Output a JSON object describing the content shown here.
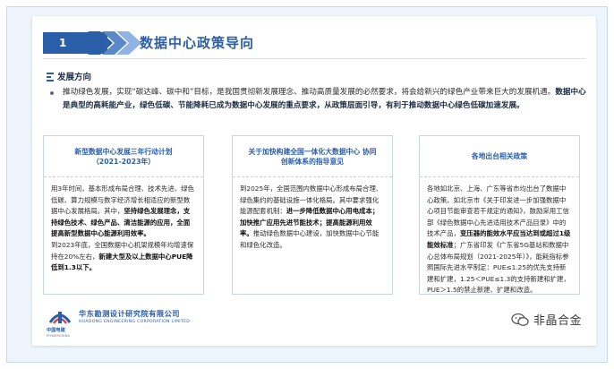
{
  "header": {
    "number": "1",
    "title": "数据中心政策导向"
  },
  "section": {
    "title": "发展方向"
  },
  "intro": {
    "normal": "推动绿色发展，实现“碳达峰、碳中和”目标，是我国贯彻新发展理念、推动高质量发展的必然要求，将会给新兴的绿色产业带来巨大的发展机遇。",
    "bold": "数据中心是典型的高耗能产业，绿色低碳、节能降耗已成为数据中心发展的重点要求，从政策层面引导，有利于推动数据中心绿色低碳加速发展。"
  },
  "cards": [
    {
      "title_line1": "新型数据中心发展三年行动计划",
      "title_line2": "（2021-2023年）",
      "p1_normal": "用3年时间，基本形成布局合理、技术先进、绿色低碳、算力规模与数字经济增长相适应的新型数据中心发展格局。其中，",
      "p1_bold": "坚持绿色发展理念，支持绿色技术、绿色产品、清洁能源的应用，全面提高新型数据中心能源利用效率。",
      "p2_normal": "到2023年底，全国数据中心机架规模年均增速保持在20%左右，",
      "p2_bold": "新建大型及以上数据中心PUE降低到1.3以下。"
    },
    {
      "title_line1": "关于加快构建全国一体化大数据中心 协同",
      "title_line2": "创新体系的指导意见",
      "p1_normal": "到2025年，全国范围内数据中心形成布局合理、绿色集约的基础设施一体化格局。其中要求强化能源配套机制：",
      "p1_bold": "进一步降低数据中心用电成本；加快推广应用先进节能技术；提高能源利用效率。",
      "p1_tail": "推动绿色数据中心建设，加快数据中心节能和绿色化改造。"
    },
    {
      "title_line1": "各地出台相关政策",
      "title_line2": "",
      "p1_normal": "各地如北京、上海、广东等省市均出台了数据中心政策。如北京市《关于印发进一步加强数据中心项目节能审查若干规定的通知》，鼓励采用工信部《绿色数据中心先进适用技术产品目录》中的技术产品，",
      "p1_bold": "变压器的能效水平应当达到或超过1级能效标准",
      "p1_tail": "；广东省印发《广东省5G基站和数据中心总体布局规划（2021-2025年）》，能耗指标参照国际先进水平制定：PUE≤1.25的优先支持新建和扩建，1.25＜PUE≤1.3的支持新建和扩建，PUE＞1.5的禁止新建、扩建和改造。"
    }
  ],
  "footer": {
    "company_cn": "华东勘测设计研究院有限公司",
    "company_en": "HUADONG ENGINEERING CORPORATION LIMITED",
    "logo_cn": "中国电建",
    "logo_sub": "POWERCHINA",
    "watermark": "非晶合金"
  },
  "colors": {
    "primary": "#2b5ea8",
    "light_chevron": "#8fb3e3"
  }
}
